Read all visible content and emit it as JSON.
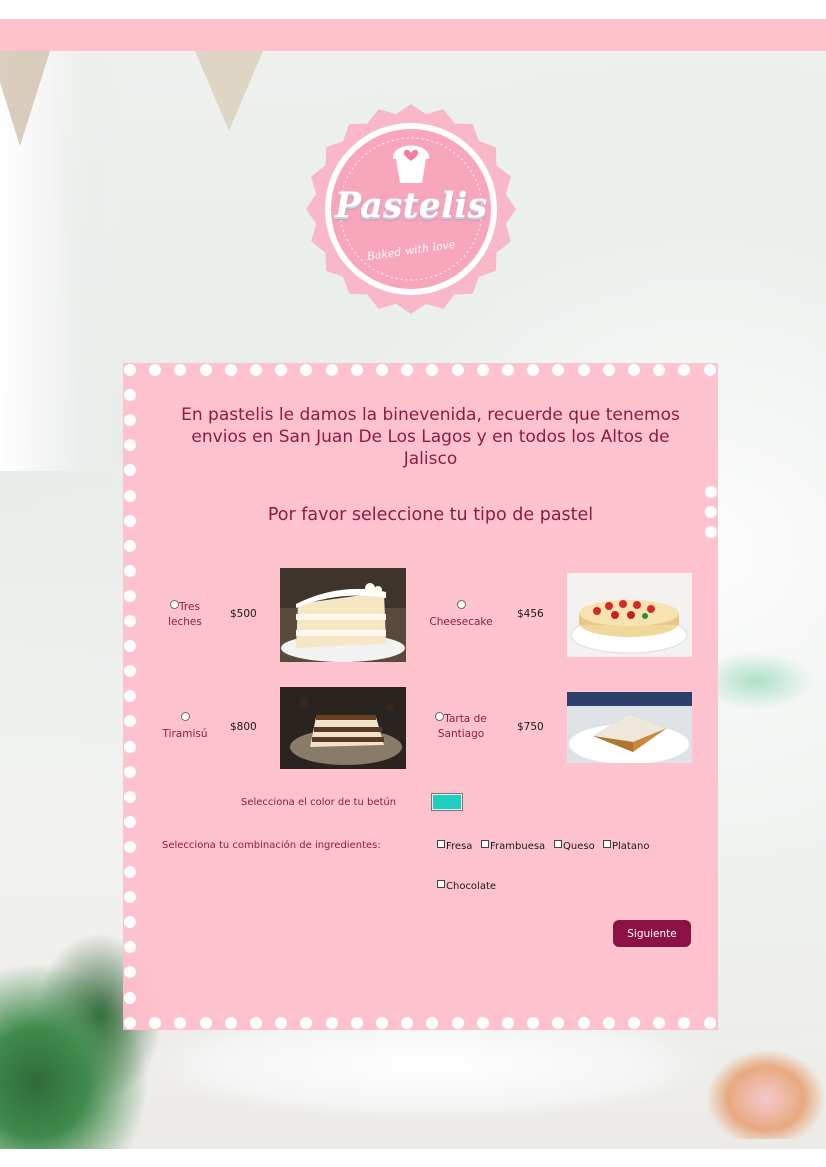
{
  "brand": {
    "name": "Pastelis",
    "tagline": "Baked with love",
    "colors": {
      "pink": "#ffc1cc",
      "badge": "#f7a6bb",
      "accent": "#8c1b45",
      "button": "#8c1245"
    }
  },
  "intro": {
    "welcome": "En pastelis le damos la binevenida, recuerde que tenemos envios en San Juan De Los Lagos y en todos los Altos de Jalisco",
    "prompt": "Por favor seleccione tu tipo de pastel"
  },
  "cakes": [
    {
      "name": "Tres leches",
      "price": "$500",
      "image": "tres-leches-slice"
    },
    {
      "name": "Cheesecake",
      "price": "$456",
      "image": "strawberry-cheesecake"
    },
    {
      "name": "Tiramisú",
      "price": "$800",
      "image": "tiramisu-slice"
    },
    {
      "name": "Tarta de Santiago",
      "price": "$750",
      "image": "almond-tart-slice"
    }
  ],
  "frosting": {
    "label": "Selecciona el color de tu betún",
    "value": "#1ccfbf"
  },
  "ingredients": {
    "label": "Selecciona tu combinación de ingredientes:",
    "options": [
      "Fresa",
      "Frambuesa",
      "Queso",
      "Platano",
      "Chocolate"
    ]
  },
  "actions": {
    "next_label": "Siguiente"
  }
}
